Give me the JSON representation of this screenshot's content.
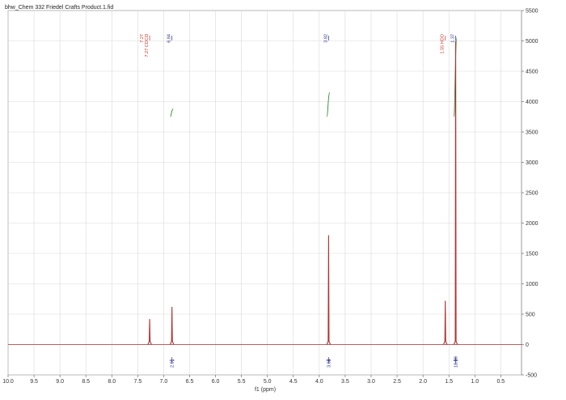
{
  "chart_data": {
    "type": "line",
    "title": "bhw_Chem 332 Friedel Crafts Product.1.fid",
    "xlabel": "f1 (ppm)",
    "ylabel": "",
    "xlim": [
      10.0,
      0.1
    ],
    "ylim": [
      -500,
      5500
    ],
    "x_ticks": [
      "10.0",
      "9.5",
      "9.0",
      "8.5",
      "8.0",
      "7.5",
      "7.0",
      "6.5",
      "6.0",
      "5.5",
      "5.0",
      "4.5",
      "4.0",
      "3.5",
      "3.0",
      "2.5",
      "2.0",
      "1.5",
      "1.0",
      "0.5"
    ],
    "y_ticks": [
      "-500",
      "0",
      "500",
      "1000",
      "1500",
      "2000",
      "2500",
      "3000",
      "3500",
      "4000",
      "4500",
      "5000",
      "5500"
    ],
    "grid": true,
    "series": [
      {
        "peaks": [
          {
            "ppm": 7.27,
            "height": 420
          },
          {
            "ppm": 6.84,
            "height": 620
          },
          {
            "ppm": 3.82,
            "height": 1800
          },
          {
            "ppm": 1.57,
            "height": 720
          },
          {
            "ppm": 1.37,
            "height": 5000
          }
        ]
      }
    ],
    "peak_labels": [
      {
        "ppm": 7.27,
        "lines": [
          "7.27",
          "7.27 CDCl3"
        ],
        "color": "#c0392b"
      },
      {
        "ppm": 6.84,
        "lines": [
          "6.84"
        ],
        "color": "#2a2f8a"
      },
      {
        "ppm": 3.82,
        "lines": [
          "3.82"
        ],
        "color": "#2a2f8a"
      },
      {
        "ppm": 1.57,
        "lines": [
          "1.55 HDO"
        ],
        "color": "#c0392b"
      },
      {
        "ppm": 1.37,
        "lines": [
          "1.37"
        ],
        "color": "#2a2f8a"
      }
    ],
    "integrals": [
      {
        "ppm": 6.84,
        "value": "2.01",
        "curve_from": 3750,
        "curve_to": 3880
      },
      {
        "ppm": 3.82,
        "value": "3.04",
        "curve_from": 3750,
        "curve_to": 4150
      },
      {
        "ppm": 1.37,
        "value": "18.00",
        "curve_from": 3750,
        "curve_to": 5050
      }
    ],
    "colors": {
      "spectrum": "#b03030",
      "integral": "#2e8b2e",
      "label_blue": "#2a2f8a",
      "label_red": "#c0392b",
      "grid": "#d9d9d9"
    }
  }
}
